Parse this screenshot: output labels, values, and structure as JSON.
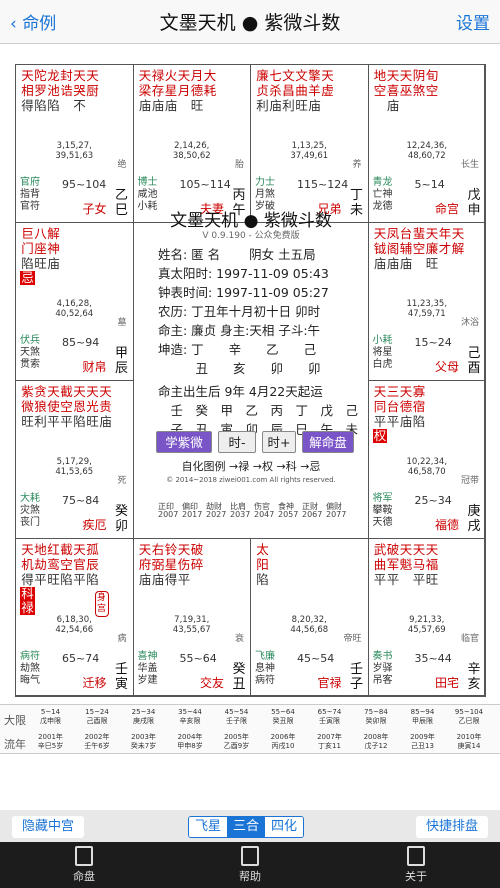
{
  "nav": {
    "back": "命例",
    "title": "文墨天机 ● 紫微斗数",
    "settings": "设置"
  },
  "cells": [
    {
      "id": "si",
      "cols": [
        [
          "天",
          "相"
        ],
        [
          "陀",
          "罗"
        ],
        [
          "龙",
          "池"
        ],
        [
          "封",
          "诰"
        ],
        [
          "天",
          "哭"
        ],
        [
          "天",
          "厨"
        ]
      ],
      "bright": [
        "得",
        "陷",
        "陷",
        "",
        "不"
      ],
      "ages": "3,15,27,\n39,51,63",
      "tag": "绝",
      "b": [
        "官府",
        "指背",
        "官符"
      ],
      "range": "95~104",
      "palace": "子女",
      "gz": "乙巳"
    },
    {
      "id": "wu",
      "cols": [
        [
          "天",
          "梁"
        ],
        [
          "禄",
          "存"
        ],
        [
          "火",
          "星"
        ],
        [
          "天",
          "月"
        ],
        [
          "月",
          "德"
        ],
        [
          "大",
          "耗"
        ]
      ],
      "bright": [
        "庙",
        "庙",
        "庙",
        "",
        "旺"
      ],
      "ages": "2,14,26,\n38,50,62",
      "tag": "胎",
      "b": [
        "博士",
        "咸池",
        "小耗"
      ],
      "range": "105~114",
      "palace": "夫妻",
      "gz": "丙午"
    },
    {
      "id": "wei",
      "cols": [
        [
          "廉",
          "贞"
        ],
        [
          "七",
          "杀"
        ],
        [
          "文",
          "昌"
        ],
        [
          "文",
          "曲"
        ],
        [
          "擎",
          "羊"
        ],
        [
          "天",
          "虚"
        ]
      ],
      "bright": [
        "利",
        "庙",
        "利",
        "旺",
        "庙"
      ],
      "ages": "1,13,25,\n37,49,61",
      "tag": "养",
      "b": [
        "力士",
        "月煞",
        "岁破"
      ],
      "range": "115~124",
      "palace": "兄弟",
      "gz": "丁未"
    },
    {
      "id": "shen",
      "cols": [
        [
          "地",
          "空"
        ],
        [
          "天",
          "喜"
        ],
        [
          "天",
          "巫"
        ],
        [
          "阴",
          "煞"
        ],
        [
          "旬",
          "空"
        ]
      ],
      "bright": [
        "",
        "庙"
      ],
      "ages": "12,24,36,\n48,60,72",
      "tag": "长生",
      "b": [
        "青龙",
        "亡神",
        "龙德"
      ],
      "range": "5~14",
      "palace": "命宫",
      "gz": "戊申"
    },
    {
      "id": "you",
      "cols": [
        [
          "天",
          "钺"
        ],
        [
          "凤",
          "阁"
        ],
        [
          "台",
          "辅"
        ],
        [
          "蜚",
          "空"
        ],
        [
          "天",
          "廉"
        ],
        [
          "年",
          "才"
        ],
        [
          "天",
          "解"
        ]
      ],
      "bright": [
        "庙",
        "庙",
        "庙",
        "",
        "旺"
      ],
      "ages": "11,23,35,\n47,59,71",
      "tag": "沐浴",
      "b": [
        "小耗",
        "将星",
        "白虎"
      ],
      "range": "15~24",
      "palace": "父母",
      "gz": "己酉"
    },
    {
      "id": "xu",
      "cols": [
        [
          "天",
          "同"
        ],
        [
          "三",
          "台"
        ],
        [
          "天",
          "德"
        ],
        [
          "寡",
          "宿"
        ]
      ],
      "bright": [
        "平",
        "平",
        "庙",
        "陷"
      ],
      "hua": "权",
      "ages": "10,22,34,\n46,58,70",
      "tag": "冠带",
      "b": [
        "将军",
        "攀鞍",
        "天德"
      ],
      "range": "25~34",
      "palace": "福德",
      "gz": "庚戌"
    },
    {
      "id": "hai",
      "cols": [
        [
          "武",
          "曲"
        ],
        [
          "破",
          "军"
        ],
        [
          "天",
          "魁"
        ],
        [
          "天",
          "马"
        ],
        [
          "天",
          "福"
        ]
      ],
      "bright": [
        "平",
        "平",
        "",
        "平",
        "旺"
      ],
      "ages": "9,21,33,\n45,57,69",
      "tag": "临官",
      "b": [
        "奏书",
        "岁驿",
        "吊客"
      ],
      "range": "35~44",
      "palace": "田宅",
      "gz": "辛亥"
    },
    {
      "id": "zi",
      "cols": [
        [
          "太",
          "阳"
        ]
      ],
      "bright": [
        "陷"
      ],
      "ages": "8,20,32,\n44,56,68",
      "tag": "帝旺",
      "b": [
        "飞廉",
        "息神",
        "病符"
      ],
      "range": "45~54",
      "palace": "官禄",
      "gz": "壬子"
    },
    {
      "id": "chou",
      "cols": [
        [
          "天",
          "府"
        ],
        [
          "右",
          "弼"
        ],
        [
          "铃",
          "星"
        ],
        [
          "天",
          "伤"
        ],
        [
          "破",
          "碎"
        ]
      ],
      "bright": [
        "庙",
        "庙",
        "得",
        "平"
      ],
      "ages": "7,19,31,\n43,55,67",
      "tag": "衰",
      "b": [
        "喜神",
        "华盖",
        "岁建"
      ],
      "range": "55~64",
      "palace": "交友",
      "gz": "癸丑"
    },
    {
      "id": "yin",
      "cols": [
        [
          "天",
          "机"
        ],
        [
          "地",
          "劫"
        ],
        [
          "红",
          "鸾"
        ],
        [
          "截",
          "空"
        ],
        [
          "天",
          "官"
        ],
        [
          "孤",
          "辰"
        ]
      ],
      "bright": [
        "得",
        "平",
        "旺",
        "陷",
        "平",
        "陷"
      ],
      "hua": "科禄",
      "ages": "6,18,30,\n42,54,66",
      "tag": "病",
      "b": [
        "病符",
        "劫煞",
        "晦气"
      ],
      "range": "65~74",
      "palace": "迁移",
      "gz": "壬寅",
      "shen": "身宫"
    },
    {
      "id": "mao",
      "cols": [
        [
          "紫",
          "微"
        ],
        [
          "贪",
          "狼"
        ],
        [
          "天",
          "使"
        ],
        [
          "截",
          "空"
        ],
        [
          "天",
          "恩"
        ],
        [
          "天",
          "光"
        ],
        [
          "天",
          "贵"
        ]
      ],
      "bright": [
        "旺",
        "利",
        "平",
        "平",
        "陷",
        "旺",
        "庙"
      ],
      "ages": "5,17,29,\n41,53,65",
      "tag": "死",
      "b": [
        "大耗",
        "灾煞",
        "丧门"
      ],
      "range": "75~84",
      "palace": "疾厄",
      "gz": "癸卯"
    },
    {
      "id": "chen",
      "cols": [
        [
          "巨",
          "门"
        ],
        [
          "八",
          "座"
        ],
        [
          "解",
          "神"
        ]
      ],
      "bright": [
        "陷",
        "旺",
        "庙"
      ],
      "hua": "忌",
      "ages": "4,16,28,\n40,52,64",
      "tag": "墓",
      "b": [
        "伏兵",
        "天煞",
        "贯索"
      ],
      "range": "85~94",
      "palace": "财帛",
      "gz": "甲辰"
    }
  ],
  "center": {
    "title": "文墨天机 ● 紫微斗数",
    "version": "V 0.9.190 - 公众免费版",
    "lines": [
      "姓名: 匿 名　　 阴女 土五局",
      "真太阳时: 1997-11-09 05:43",
      "钟表时间: 1997-11-09 05:27",
      "农历: 丁丑年十月初十日 卯时",
      "命主: 廉贞 身主:天相 子斗:午",
      "坤造: 丁　　辛　　乙　　己",
      "　　　丑　　亥　　卯　　卯",
      "命主出生后 9年 4月22天起运",
      "　壬　癸　甲　乙　丙　丁　戊　己",
      "　子　丑　寅　卯　辰　巳　午　未"
    ],
    "dayun": [
      "正印",
      "偏印",
      "劫财",
      "比肩",
      "伤官",
      "食神",
      "正财",
      "偏财"
    ],
    "years": [
      "2007",
      "2017",
      "2027",
      "2037",
      "2047",
      "2057",
      "2067",
      "2077"
    ],
    "btns": [
      "学紫微",
      "时-",
      "时+",
      "解命盘"
    ],
    "ziLabel": "自化图例 →禄 →权 →科 →忌",
    "copy": "© 2014~2018 ziwei001.com All rights reserved."
  },
  "decade_label": "大限",
  "year_label": "流年",
  "decades": [
    [
      "5~14",
      "戊申限"
    ],
    [
      "15~24",
      "己酉限"
    ],
    [
      "25~34",
      "庚戌限"
    ],
    [
      "35~44",
      "辛亥限"
    ],
    [
      "45~54",
      "壬子限"
    ],
    [
      "55~64",
      "癸丑限"
    ],
    [
      "65~74",
      "壬寅限"
    ],
    [
      "75~84",
      "癸卯限"
    ],
    [
      "85~94",
      "甲辰限"
    ],
    [
      "95~104",
      "乙巳限"
    ]
  ],
  "years": [
    [
      "2001年",
      "辛巳5岁"
    ],
    [
      "2002年",
      "壬午6岁"
    ],
    [
      "2003年",
      "癸未7岁"
    ],
    [
      "2004年",
      "甲申8岁"
    ],
    [
      "2005年",
      "乙酉9岁"
    ],
    [
      "2006年",
      "丙戌10"
    ],
    [
      "2007年",
      "丁亥11"
    ],
    [
      "2008年",
      "戊子12"
    ],
    [
      "2009年",
      "己丑13"
    ],
    [
      "2010年",
      "庚寅14"
    ]
  ],
  "bottom": {
    "left": "隐藏中宫",
    "seg": [
      "飞星",
      "三合",
      "四化"
    ],
    "right": "快捷排盘"
  },
  "tabs": [
    "命盘",
    "帮助",
    "关于"
  ]
}
